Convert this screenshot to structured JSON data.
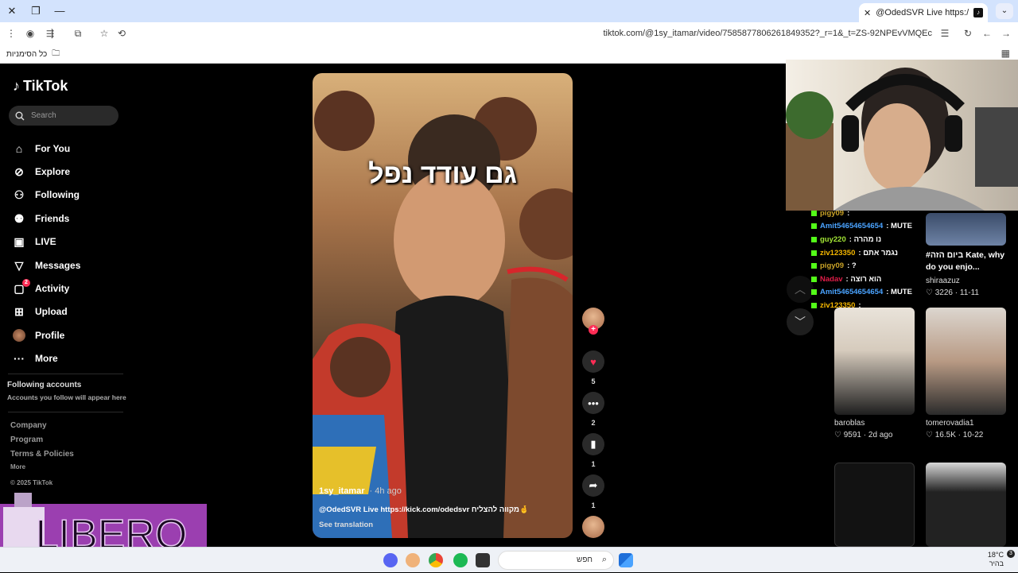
{
  "browser": {
    "tab_title": "@OdedSVR Live https://kick.co",
    "url": "tiktok.com/@1sy_itamar/video/7585877806261849352?_r=1&_t=ZS-92NPEvVMQEc",
    "bookmarks_all": "כל הסימניות"
  },
  "sidebar": {
    "logo": "TikTok",
    "search_placeholder": "Search",
    "items": [
      {
        "label": "For You",
        "icon": "home-icon"
      },
      {
        "label": "Explore",
        "icon": "compass-icon"
      },
      {
        "label": "Following",
        "icon": "following-icon"
      },
      {
        "label": "Friends",
        "icon": "friends-icon"
      },
      {
        "label": "LIVE",
        "icon": "live-icon"
      },
      {
        "label": "Messages",
        "icon": "messages-icon"
      },
      {
        "label": "Activity",
        "icon": "activity-icon",
        "badge": "2"
      },
      {
        "label": "Upload",
        "icon": "upload-icon"
      },
      {
        "label": "Profile",
        "icon": "profile-avatar"
      },
      {
        "label": "More",
        "icon": "more-icon"
      }
    ],
    "following_heading": "Following accounts",
    "following_sub": "Accounts you follow will appear here",
    "footer": [
      "Company",
      "Program",
      "Terms & Policies"
    ],
    "footer_more": "More",
    "copyright": "© 2025 TikTok"
  },
  "video": {
    "overlay_text": "גם עודד נפל",
    "author": "1sy_itamar",
    "ago": "· 4h ago",
    "caption": "@OdedSVR Live  https://kick.com/odedsvr מקווה להצליח🤞",
    "see_translation": "See translation",
    "likes": "5",
    "comments": "2",
    "saves": "1",
    "shares": "1"
  },
  "chat": [
    {
      "user": "pigy09",
      "text": ":",
      "color": "#c9a227"
    },
    {
      "user": "Amit54654654654",
      "text": ": MUTE",
      "color": "#4aa3ff"
    },
    {
      "user": "guy220",
      "text": ": נו מהרה",
      "color": "#a3e635"
    },
    {
      "user": "ziv123350",
      "text": ": נגמר אתם",
      "color": "#f5b700"
    },
    {
      "user": "pigy09",
      "text": ": ?",
      "color": "#c9a227"
    },
    {
      "user": "Nadav",
      "text": ": הוא רוצה",
      "color": "#e11d48"
    },
    {
      "user": "Amit54654654654",
      "text": ": MUTE",
      "color": "#4aa3ff"
    },
    {
      "user": "ziv123350",
      "text": ":",
      "color": "#f5b700"
    }
  ],
  "related": [
    {
      "title": "#ביום הזה Kate, why do you enjo...",
      "author": "shiraazuz",
      "likes": "3226",
      "date": "11-11"
    },
    {
      "author": "baroblas",
      "likes": "9591",
      "date": "2d ago"
    },
    {
      "author": "tomerovadia1",
      "likes": "16.5K",
      "date": "10-22"
    }
  ],
  "taskbar": {
    "search_label": "חפש",
    "temp": "18°C",
    "weather": "בהיר",
    "notif": "3"
  },
  "ad": {
    "brand": "LIBERO"
  },
  "colors": {
    "accent": "#fe2c55",
    "kick": "#53fc18"
  }
}
